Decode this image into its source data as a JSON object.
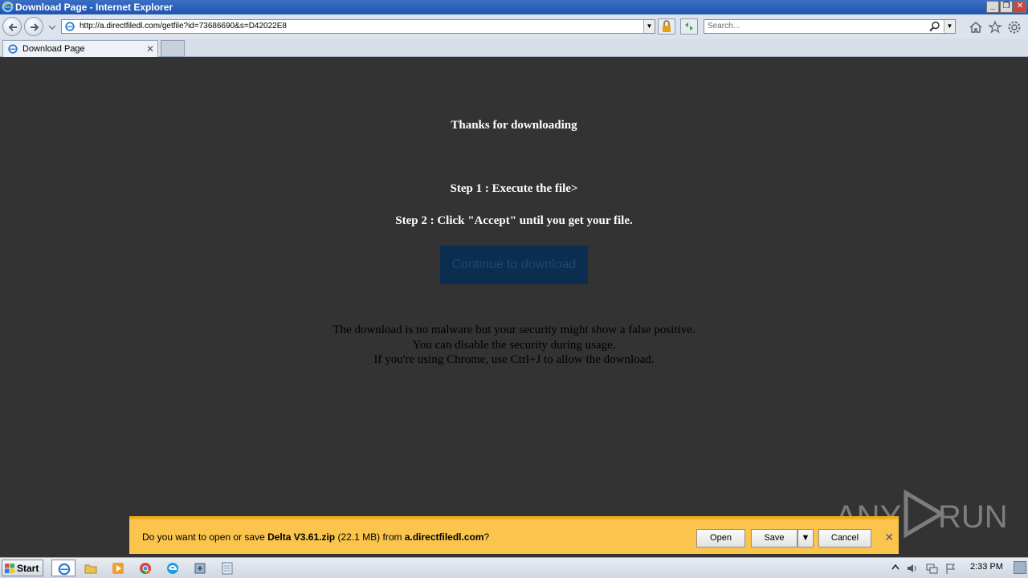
{
  "window": {
    "title": "Download Page - Internet Explorer",
    "controls": [
      "_",
      "❐",
      "✕"
    ]
  },
  "navbar": {
    "url": "http://a.directfiledl.com/getfile?id=73686690&s=D42022E8",
    "search_placeholder": "Search..."
  },
  "tabs": [
    {
      "label": "Download Page",
      "close": "✕"
    }
  ],
  "page": {
    "heading": "Thanks for downloading",
    "step1": "Step 1 : Execute the file>",
    "step2": "Step 2 : Click \"Accept\" until you get your file.",
    "continue_label": "Continue to download",
    "note_line1": "The download is no malware but your security might show a false positive.",
    "note_line2": "You can disable the security during usage.",
    "note_line3": "If you're using Chrome, use Ctrl+J to allow the download."
  },
  "notification": {
    "prefix": "Do you want to open or save ",
    "filename": "Delta V3.61.zip",
    "size": " (22.1 MB) from ",
    "domain": "a.directfiledl.com",
    "suffix": "?",
    "open_label": "Open",
    "save_label": "Save",
    "cancel_label": "Cancel",
    "close": "✕"
  },
  "watermark": {
    "left": "ANY",
    "right": "RUN"
  },
  "taskbar": {
    "start_label": "Start",
    "time": "2:33 PM"
  },
  "colors": {
    "page_bg": "#333333",
    "continue_bg": "#0b2d4f",
    "notify_bg": "#fbc54d",
    "titlebar": "#1f55b0"
  }
}
